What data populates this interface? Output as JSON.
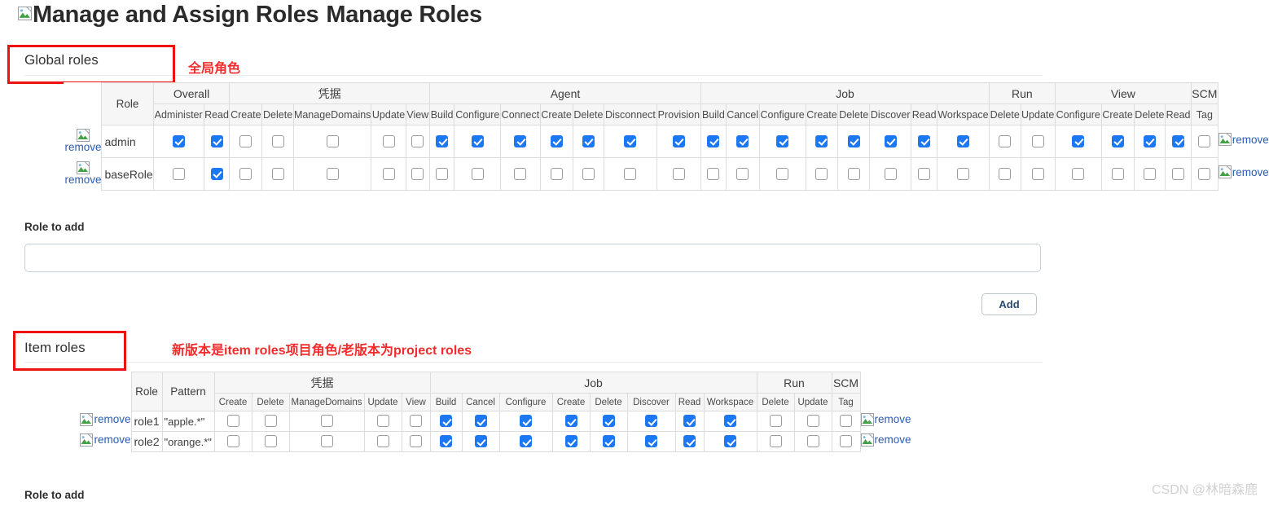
{
  "page": {
    "title_main": "Manage and Assign Roles",
    "title_sub": "Manage Roles",
    "broken_image_icon": "broken-image-icon",
    "watermark": "CSDN @林暗森鹿"
  },
  "global_section": {
    "heading": "Global roles",
    "annotation": "全局角色",
    "remove_label": "remove",
    "table": {
      "role_header": "Role",
      "groups": [
        {
          "label": "Overall",
          "columns": [
            "Administer",
            "Read"
          ]
        },
        {
          "label": "凭据",
          "columns": [
            "Create",
            "Delete",
            "ManageDomains",
            "Update",
            "View"
          ]
        },
        {
          "label": "Agent",
          "columns": [
            "Build",
            "Configure",
            "Connect",
            "Create",
            "Delete",
            "Disconnect",
            "Provision"
          ]
        },
        {
          "label": "Job",
          "columns": [
            "Build",
            "Cancel",
            "Configure",
            "Create",
            "Delete",
            "Discover",
            "Read",
            "Workspace"
          ]
        },
        {
          "label": "Run",
          "columns": [
            "Delete",
            "Update"
          ]
        },
        {
          "label": "View",
          "columns": [
            "Configure",
            "Create",
            "Delete",
            "Read"
          ]
        },
        {
          "label": "SCM",
          "columns": [
            "Tag"
          ]
        }
      ],
      "rows": [
        {
          "role": "admin",
          "checks": [
            true,
            true,
            false,
            false,
            false,
            false,
            false,
            true,
            true,
            true,
            true,
            true,
            true,
            true,
            true,
            true,
            true,
            true,
            true,
            true,
            true,
            true,
            false,
            false,
            true,
            true,
            true,
            true,
            false
          ]
        },
        {
          "role": "baseRole",
          "checks": [
            false,
            true,
            false,
            false,
            false,
            false,
            false,
            false,
            false,
            false,
            false,
            false,
            false,
            false,
            false,
            false,
            false,
            false,
            false,
            false,
            false,
            false,
            false,
            false,
            false,
            false,
            false,
            false,
            false
          ]
        }
      ]
    },
    "role_to_add_label": "Role to add",
    "role_to_add_value": "",
    "role_to_add_placeholder": "",
    "add_button": "Add"
  },
  "item_section": {
    "heading": "Item roles",
    "annotation": "新版本是item roles项目角色/老版本为project roles",
    "remove_label": "remove",
    "table": {
      "role_header": "Role",
      "pattern_header": "Pattern",
      "groups": [
        {
          "label": "凭据",
          "columns": [
            "Create",
            "Delete",
            "ManageDomains",
            "Update",
            "View"
          ]
        },
        {
          "label": "Job",
          "columns": [
            "Build",
            "Cancel",
            "Configure",
            "Create",
            "Delete",
            "Discover",
            "Read",
            "Workspace"
          ]
        },
        {
          "label": "Run",
          "columns": [
            "Delete",
            "Update"
          ]
        },
        {
          "label": "SCM",
          "columns": [
            "Tag"
          ]
        }
      ],
      "rows": [
        {
          "role": "role1",
          "pattern": "\"apple.*\"",
          "checks": [
            false,
            false,
            false,
            false,
            false,
            true,
            true,
            true,
            true,
            true,
            true,
            true,
            true,
            false,
            false,
            false
          ]
        },
        {
          "role": "role2",
          "pattern": "\"orange.*\"",
          "checks": [
            false,
            false,
            false,
            false,
            false,
            true,
            true,
            true,
            true,
            true,
            true,
            true,
            true,
            false,
            false,
            false
          ]
        }
      ]
    },
    "role_to_add_label": "Role to add"
  }
}
